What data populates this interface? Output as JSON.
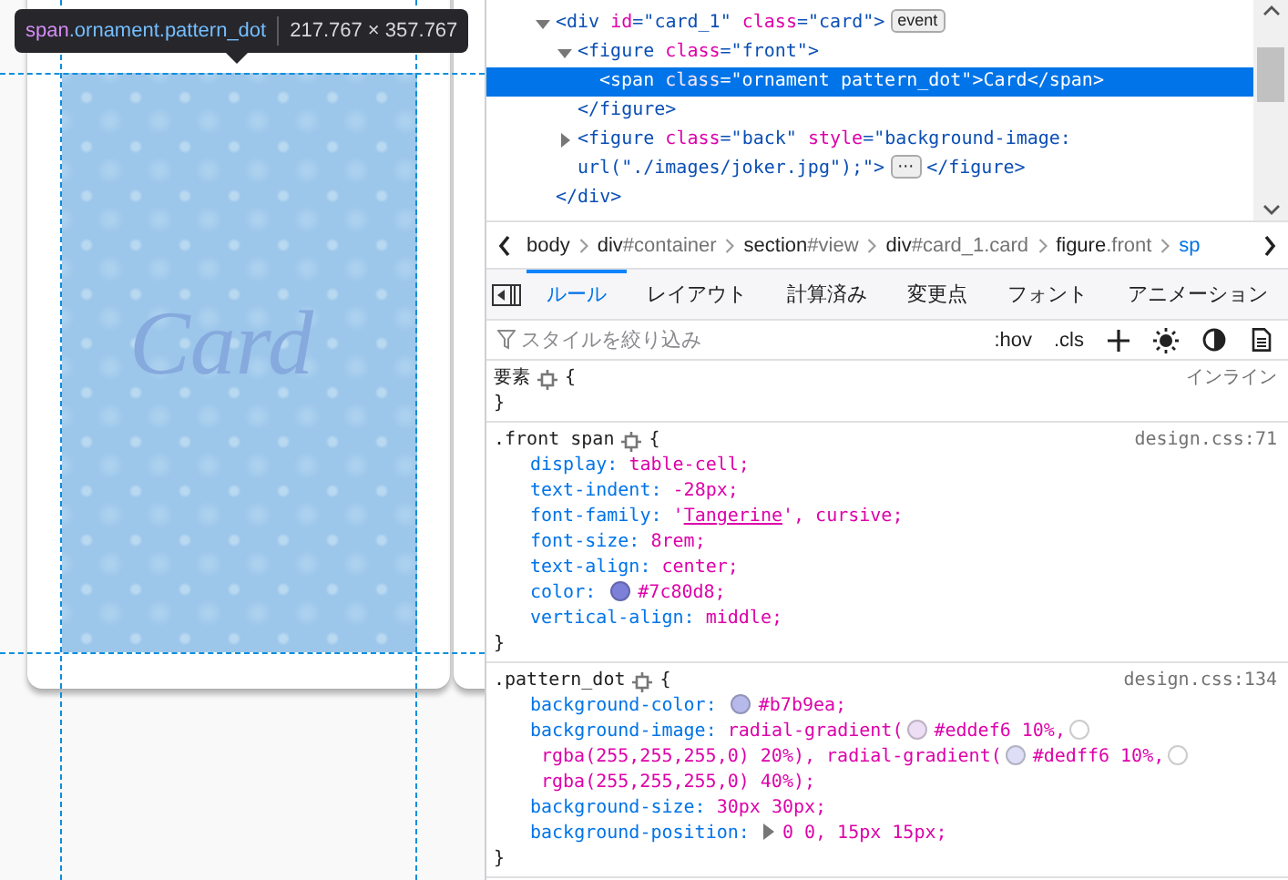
{
  "preview": {
    "card_text": "Card",
    "tooltip": {
      "tag": "span",
      "classes": ".ornament.pattern_dot",
      "size": "217.767 × 357.767"
    }
  },
  "markup": {
    "nodes": [
      {
        "expanded": true,
        "selected": false,
        "open": [
          {
            "kind": "tag",
            "text": "<div "
          },
          {
            "kind": "attr",
            "text": "id"
          },
          {
            "kind": "tag",
            "text": "=\"card_1\" "
          },
          {
            "kind": "attr",
            "text": "class"
          },
          {
            "kind": "tag",
            "text": "=\"card\">"
          },
          {
            "kind": "badge",
            "text": "event"
          }
        ],
        "close": [
          {
            "kind": "tag",
            "text": "</div>"
          }
        ],
        "children": [
          {
            "expanded": true,
            "selected": false,
            "open": [
              {
                "kind": "tag",
                "text": "<figure "
              },
              {
                "kind": "attr",
                "text": "class"
              },
              {
                "kind": "tag",
                "text": "=\"front\">"
              }
            ],
            "close": [
              {
                "kind": "tag",
                "text": "</figure>"
              }
            ],
            "children": [
              {
                "selected": true,
                "open": [
                  {
                    "kind": "tag",
                    "text": "<span "
                  },
                  {
                    "kind": "attr",
                    "text": "class"
                  },
                  {
                    "kind": "tag",
                    "text": "=\"ornament pattern_dot\">"
                  },
                  {
                    "kind": "text",
                    "text": "Card"
                  },
                  {
                    "kind": "tag",
                    "text": "</span>"
                  }
                ]
              }
            ]
          },
          {
            "expanded": false,
            "selected": false,
            "open": [
              {
                "kind": "tag",
                "text": "<figure "
              },
              {
                "kind": "attr",
                "text": "class"
              },
              {
                "kind": "tag",
                "text": "=\"back\" "
              },
              {
                "kind": "attr",
                "text": "style"
              },
              {
                "kind": "tag",
                "text": "=\"background-image: url(\"./images/joker.jpg\");\">"
              },
              {
                "kind": "badge",
                "text": "⋯"
              }
            ],
            "close": [
              {
                "kind": "tag",
                "text": "</figure>"
              }
            ]
          }
        ]
      }
    ]
  },
  "breadcrumbs": [
    {
      "element": "body",
      "selected": false
    },
    {
      "element": "div",
      "detail": "#container",
      "selected": false
    },
    {
      "element": "section",
      "detail": "#view",
      "selected": false
    },
    {
      "element": "div",
      "detail": "#card_1.card",
      "selected": false
    },
    {
      "element": "figure",
      "detail": ".front",
      "selected": false
    },
    {
      "element": "sp",
      "selected": true
    }
  ],
  "tabs": [
    {
      "label": "ルール",
      "selected": true
    },
    {
      "label": "レイアウト",
      "selected": false
    },
    {
      "label": "計算済み",
      "selected": false
    },
    {
      "label": "変更点",
      "selected": false
    },
    {
      "label": "フォント",
      "selected": false
    },
    {
      "label": "アニメーション",
      "selected": false
    }
  ],
  "filter": {
    "placeholder": "スタイルを絞り込み",
    "buttons": [
      ":hov",
      ".cls"
    ]
  },
  "rules": [
    {
      "selector": "要素",
      "open": "{",
      "close": "}",
      "source": "インライン"
    },
    {
      "selector": ".front span",
      "open": "{",
      "close": "}",
      "source": "design.css:71",
      "declarations": [
        {
          "property": "display:",
          "value": [
            {
              "kind": "value",
              "text": "table-cell;"
            }
          ]
        },
        {
          "property": "text-indent:",
          "value": [
            {
              "kind": "value",
              "text": "-28px;"
            }
          ]
        },
        {
          "property": "font-family:",
          "value": [
            {
              "kind": "value",
              "text": "'"
            },
            {
              "kind": "link",
              "text": "Tangerine"
            },
            {
              "kind": "value",
              "text": "', cursive;"
            }
          ]
        },
        {
          "property": "font-size:",
          "value": [
            {
              "kind": "value",
              "text": "8rem;"
            }
          ]
        },
        {
          "property": "text-align:",
          "value": [
            {
              "kind": "value",
              "text": "center;"
            }
          ]
        },
        {
          "property": "color:",
          "value": [
            {
              "kind": "swatch",
              "color": "#7c80d8"
            },
            {
              "kind": "value",
              "text": "#7c80d8;"
            }
          ]
        },
        {
          "property": "vertical-align:",
          "value": [
            {
              "kind": "value",
              "text": "middle;"
            }
          ]
        }
      ]
    },
    {
      "selector": ".pattern_dot",
      "open": "{",
      "close": "}",
      "source": "design.css:134",
      "declarations": [
        {
          "property": "background-color:",
          "value": [
            {
              "kind": "swatch",
              "color": "#b7b9ea"
            },
            {
              "kind": "value",
              "text": "#b7b9ea;"
            }
          ]
        },
        {
          "property": "background-image:",
          "value": [
            {
              "kind": "value",
              "text": "radial-gradient("
            },
            {
              "kind": "swatch",
              "color": "#eddef6"
            },
            {
              "kind": "value",
              "text": "#eddef6 10%,"
            },
            {
              "kind": "swatch",
              "color": "#ffffff"
            },
            {
              "kind": "value",
              "text": "rgba(255,255,255,0) 20%), radial-gradient("
            },
            {
              "kind": "swatch",
              "color": "#dedff6"
            },
            {
              "kind": "value",
              "text": "#dedff6 10%,"
            },
            {
              "kind": "swatch",
              "color": "#ffffff"
            },
            {
              "kind": "value",
              "text": "rgba(255,255,255,0) 40%);"
            }
          ]
        },
        {
          "property": "background-size:",
          "value": [
            {
              "kind": "value",
              "text": "30px 30px;"
            }
          ]
        },
        {
          "property": "background-position:",
          "value": [
            {
              "kind": "expander"
            },
            {
              "kind": "value",
              "text": "0 0, 15px 15px;"
            }
          ]
        }
      ]
    }
  ]
}
